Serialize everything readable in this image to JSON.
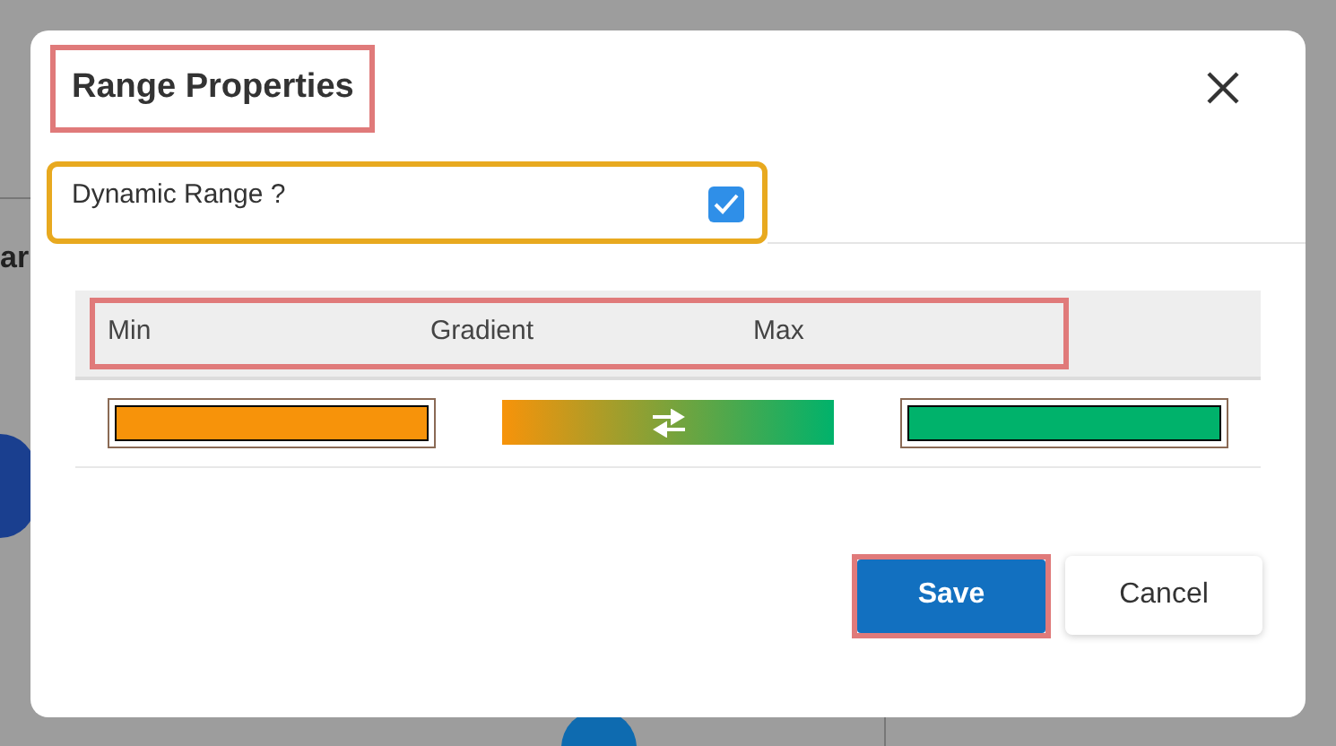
{
  "background": {
    "text": "ar"
  },
  "dialog": {
    "title": "Range Properties",
    "dynamic_range": {
      "label": "Dynamic Range ?",
      "checked": true
    },
    "table": {
      "columns": [
        "Min",
        "Gradient",
        "Max"
      ],
      "min": {
        "color": "#f7930a"
      },
      "max": {
        "color": "#00b26b"
      }
    },
    "buttons": [
      {
        "label": "Save",
        "kind": "primary"
      },
      {
        "label": "Cancel",
        "kind": "secondary"
      }
    ]
  }
}
